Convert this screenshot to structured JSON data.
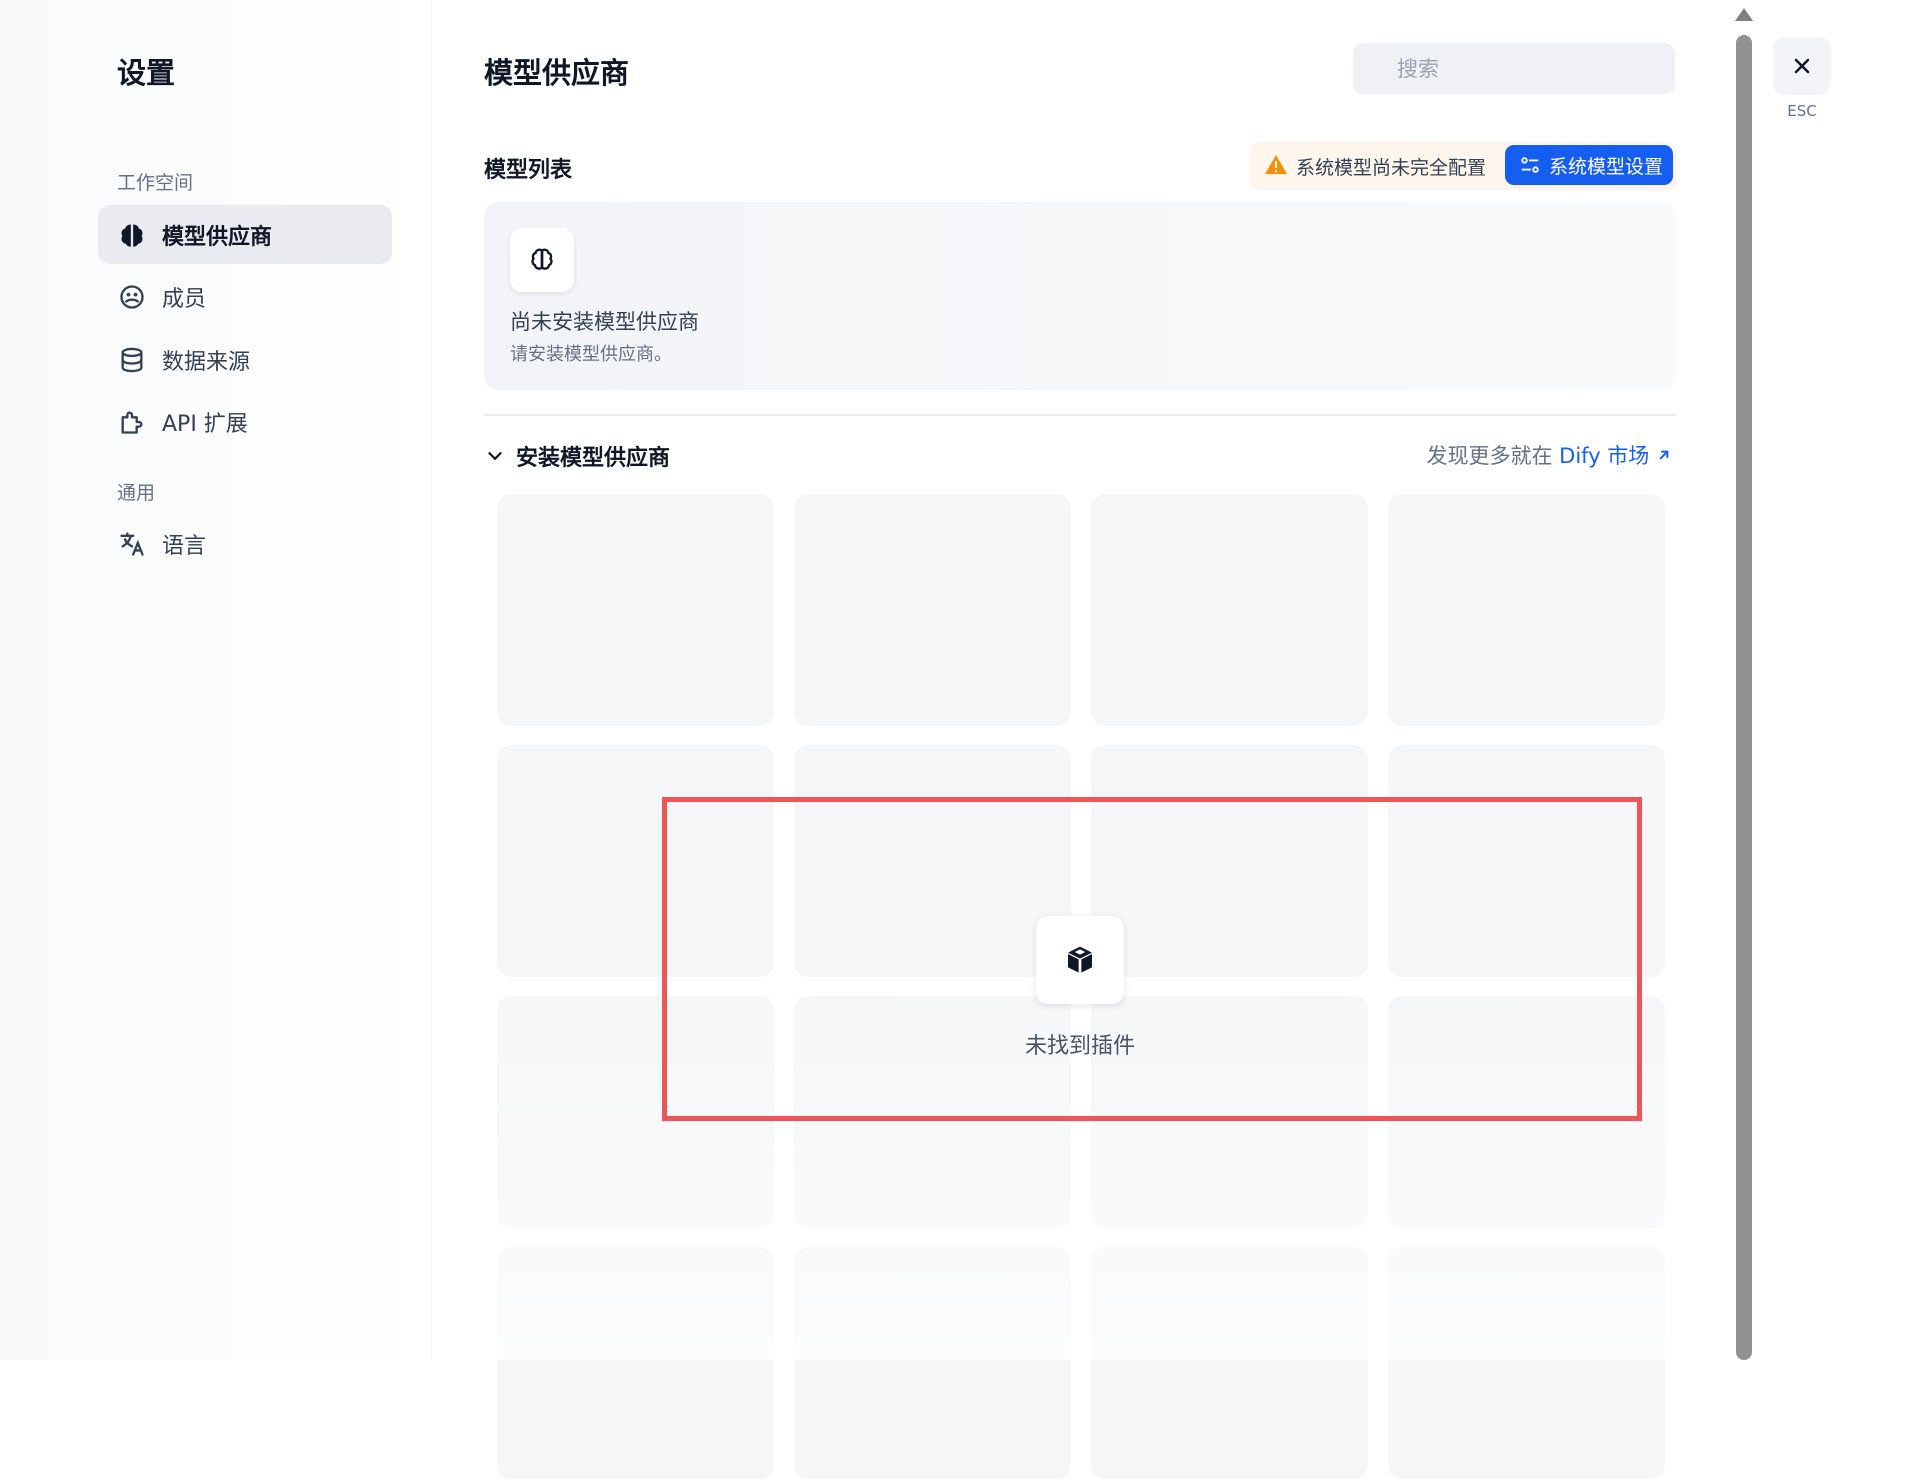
{
  "sidebar": {
    "title": "设置",
    "groups": [
      {
        "label": "工作空间"
      },
      {
        "label": "通用"
      }
    ],
    "items": [
      {
        "label": "模型供应商",
        "icon": "brain-icon",
        "active": true
      },
      {
        "label": "成员",
        "icon": "members-icon"
      },
      {
        "label": "数据来源",
        "icon": "database-icon"
      },
      {
        "label": "API 扩展",
        "icon": "puzzle-icon"
      },
      {
        "label": "语言",
        "icon": "translate-icon"
      }
    ]
  },
  "main": {
    "title": "模型供应商",
    "search": {
      "placeholder": "搜索"
    },
    "model_list": {
      "title": "模型列表",
      "warning_text": "系统模型尚未完全配置",
      "system_settings_label": "系统模型设置",
      "empty_title": "尚未安装模型供应商",
      "empty_desc": "请安装模型供应商。"
    },
    "install": {
      "title": "安装模型供应商",
      "discover_prefix": "发现更多就在",
      "discover_link": "Dify 市场",
      "not_found": "未找到插件"
    }
  },
  "close": {
    "label": "ESC"
  },
  "colors": {
    "accent": "#155eef",
    "warning": "#f79009",
    "highlight": "#ee5557"
  }
}
